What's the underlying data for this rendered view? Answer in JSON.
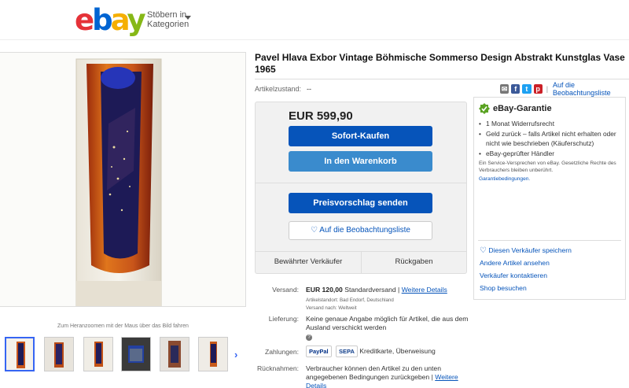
{
  "header": {
    "logo_letters": [
      "e",
      "b",
      "a",
      "y"
    ],
    "browse_line1": "Stöbern in",
    "browse_line2": "Kategorien"
  },
  "gallery": {
    "zoom_hint": "Zum Heranzoomen mit der Maus über das Bild fahren",
    "thumbnail_count": 6,
    "next_icon": "chevron-right-icon"
  },
  "listing": {
    "title": "Pavel Hlava Exbor Vintage Böhmische Sommerso Design Abstrakt Kunstglas Vase 1965",
    "condition_label": "Artikelzustand:",
    "condition_value": "--",
    "share_icons": [
      "email-icon",
      "facebook-icon",
      "twitter-icon",
      "pinterest-icon"
    ],
    "watch_link": "Auf die Beobachtungsliste"
  },
  "buy_box": {
    "price": "EUR 599,90",
    "buy_now": "Sofort-Kaufen",
    "add_to_cart": "In den Warenkorb",
    "make_offer": "Preisvorschlag senden",
    "watchlist": "Auf die Beobachtungsliste",
    "trusted_seller": "Bewährter Verkäufer",
    "returns": "Rückgaben"
  },
  "guarantee": {
    "title": "eBay-Garantie",
    "items": [
      "1 Monat Widerrufsrecht",
      "Geld zurück – falls Artikel nicht erhalten oder nicht wie beschrieben (Käuferschutz)",
      "eBay-geprüfter Händler"
    ],
    "note": "Ein Service-Versprechen von eBay. Gesetzliche Rechte des Verbrauchers bleiben unberührt.",
    "terms_link": "Garantiebedingungen.",
    "save_seller": "Diesen Verkäufer speichern",
    "other_items": "Andere Artikel ansehen",
    "contact_seller": "Verkäufer kontaktieren",
    "visit_shop": "Shop besuchen"
  },
  "details": {
    "shipping_label": "Versand:",
    "shipping_price": "EUR 120,00",
    "shipping_method": "Standardversand |",
    "shipping_more": "Weitere Details",
    "item_location": "Artikelstandort: Bad Endorf, Deutschland",
    "ships_to": "Versand nach: Weltweit",
    "delivery_label": "Lieferung:",
    "delivery_text": "Keine genaue Angabe möglich für Artikel, die aus dem Ausland verschickt werden",
    "payments_label": "Zahlungen:",
    "payment_badge_1": "PayPal",
    "payment_badge_2": "SEPA",
    "payments_text": "Kreditkarte, Überweisung",
    "returns_label": "Rücknahmen:",
    "returns_text": "Verbraucher können den Artikel zu den unten angegebenen Bedingungen zurückgeben |",
    "returns_more": "Weitere Details"
  },
  "colors": {
    "link": "#0654ba",
    "buy_button": "#0654ba",
    "cart_button": "#3a8bcd",
    "guarantee_check": "#5ba323"
  }
}
